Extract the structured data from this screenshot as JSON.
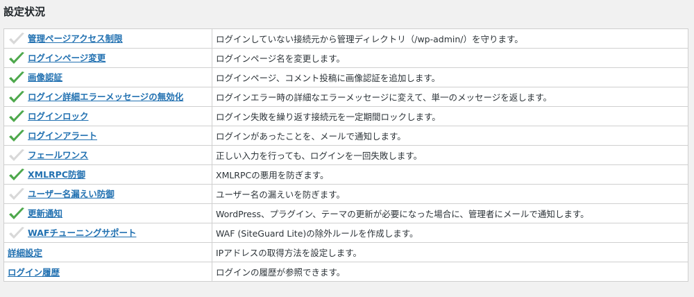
{
  "header": {
    "title": "設定状況"
  },
  "colors": {
    "enabled_check": "#4ea84c",
    "disabled_check": "#d8d8d8",
    "link": "#2271b1"
  },
  "rows": [
    {
      "name": "管理ページアクセス制限",
      "description": "ログインしていない接続元から管理ディレクトリ（/wp-admin/）を守ります。",
      "status": "disabled",
      "icon": "check-icon"
    },
    {
      "name": "ログインページ変更",
      "description": "ログインページ名を変更します。",
      "status": "enabled",
      "icon": "check-icon"
    },
    {
      "name": "画像認証",
      "description": "ログインページ、コメント投稿に画像認証を追加します。",
      "status": "enabled",
      "icon": "check-icon"
    },
    {
      "name": "ログイン詳細エラーメッセージの無効化",
      "description": "ログインエラー時の詳細なエラーメッセージに変えて、単一のメッセージを返します。",
      "status": "enabled",
      "icon": "check-icon"
    },
    {
      "name": "ログインロック",
      "description": "ログイン失敗を繰り返す接続元を一定期間ロックします。",
      "status": "enabled",
      "icon": "check-icon"
    },
    {
      "name": "ログインアラート",
      "description": "ログインがあったことを、メールで通知します。",
      "status": "enabled",
      "icon": "check-icon"
    },
    {
      "name": "フェールワンス",
      "description": "正しい入力を行っても、ログインを一回失敗します。",
      "status": "disabled",
      "icon": "check-icon"
    },
    {
      "name": "XMLRPC防御",
      "description": "XMLRPCの悪用を防ぎます。",
      "status": "enabled",
      "icon": "check-icon"
    },
    {
      "name": "ユーザー名漏えい防御",
      "description": "ユーザー名の漏えいを防ぎます。",
      "status": "disabled",
      "icon": "check-icon"
    },
    {
      "name": "更新通知",
      "description": "WordPress、プラグイン、テーマの更新が必要になった場合に、管理者にメールで通知します。",
      "status": "enabled",
      "icon": "check-icon"
    },
    {
      "name": "WAFチューニングサポート",
      "description": "WAF (SiteGuard Lite)の除外ルールを作成します。",
      "status": "disabled",
      "icon": "check-icon"
    },
    {
      "name": "詳細設定",
      "description": "IPアドレスの取得方法を設定します。",
      "status": "none"
    },
    {
      "name": "ログイン履歴",
      "description": "ログインの履歴が参照できます。",
      "status": "none"
    }
  ]
}
